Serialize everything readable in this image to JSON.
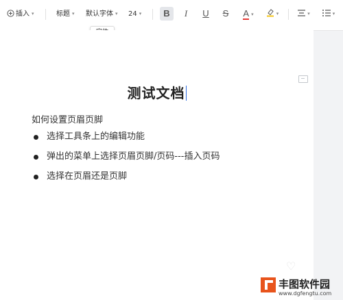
{
  "toolbar": {
    "insert_label": "插入",
    "heading_label": "标题",
    "font_label": "默认字体",
    "size_label": "24",
    "font_tooltip": "字体"
  },
  "icons": {
    "bold": "B",
    "italic": "I",
    "underline": "U",
    "strike": "S",
    "font_color": "A",
    "font_color_hex": "#e53935",
    "highlight_hex": "#f5c518"
  },
  "document": {
    "title": "测试文档",
    "paragraph": "如何设置页眉页脚",
    "bullets": [
      "选择工具条上的编辑功能",
      "弹出的菜单上选择页眉页脚/页码---插入页码",
      "选择在页眉还是页脚"
    ]
  },
  "watermark": {
    "name": "丰图软件园",
    "url": "www.dgfengtu.com",
    "accent": "#e8541c"
  }
}
